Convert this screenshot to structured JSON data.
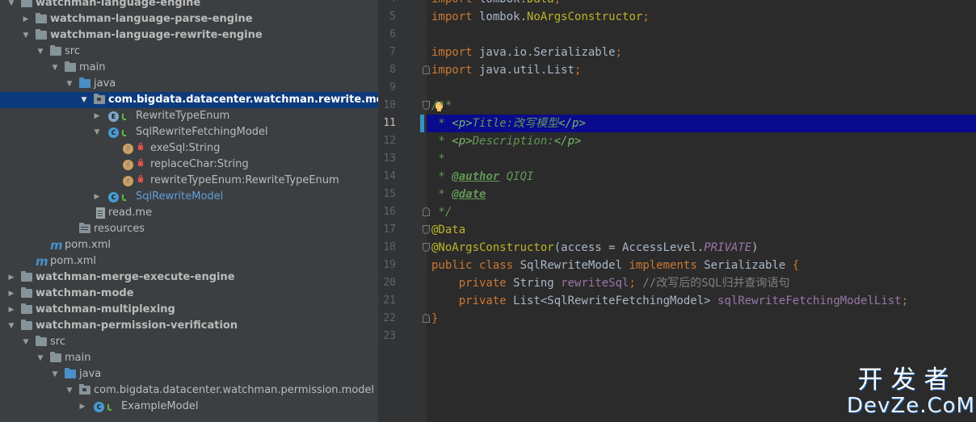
{
  "project_tree": {
    "items": [
      {
        "label": "watchman-language-engine",
        "expanded": true,
        "type": "module",
        "bold": true
      },
      {
        "label": "watchman-language-parse-engine",
        "expanded": false,
        "type": "module",
        "bold": true
      },
      {
        "label": "watchman-language-rewrite-engine",
        "expanded": true,
        "type": "module",
        "bold": true
      },
      {
        "label": "src",
        "expanded": true,
        "type": "folder"
      },
      {
        "label": "main",
        "expanded": true,
        "type": "folder"
      },
      {
        "label": "java",
        "expanded": true,
        "type": "source-folder"
      },
      {
        "label": "com.bigdata.datacenter.watchman.rewrite.model",
        "expanded": true,
        "type": "package",
        "selected": true
      },
      {
        "label": "RewriteTypeEnum",
        "expanded": false,
        "type": "enum"
      },
      {
        "label": "SqlRewriteFetchingModel",
        "expanded": true,
        "type": "class"
      },
      {
        "label": "exeSql:String",
        "type": "field"
      },
      {
        "label": "replaceChar:String",
        "type": "field"
      },
      {
        "label": "rewriteTypeEnum:RewriteTypeEnum",
        "type": "field"
      },
      {
        "label": "SqlRewriteModel",
        "expanded": false,
        "type": "class",
        "highlight": true
      },
      {
        "label": "read.me",
        "type": "file"
      },
      {
        "label": "resources",
        "type": "resources-folder"
      },
      {
        "label": "pom.xml",
        "type": "maven"
      },
      {
        "label": "pom.xml",
        "type": "maven"
      },
      {
        "label": "watchman-merge-execute-engine",
        "expanded": false,
        "type": "module",
        "bold": true
      },
      {
        "label": "watchman-mode",
        "expanded": false,
        "type": "module",
        "bold": true
      },
      {
        "label": "watchman-multiplexing",
        "expanded": false,
        "type": "module",
        "bold": true
      },
      {
        "label": "watchman-permission-verification",
        "expanded": true,
        "type": "module",
        "bold": true
      },
      {
        "label": "src",
        "expanded": true,
        "type": "folder"
      },
      {
        "label": "main",
        "expanded": true,
        "type": "folder"
      },
      {
        "label": "java",
        "expanded": true,
        "type": "source-folder"
      },
      {
        "label": "com.bigdata.datacenter.watchman.permission.model",
        "expanded": true,
        "type": "package"
      },
      {
        "label": "ExampleModel",
        "expanded": false,
        "type": "class"
      }
    ]
  },
  "editor": {
    "current_line": 11,
    "lines": [
      {
        "n": "4",
        "text": "import lombok.Data;"
      },
      {
        "n": "5",
        "text": "import lombok.NoArgsConstructor;"
      },
      {
        "n": "6",
        "text": ""
      },
      {
        "n": "7",
        "text": "import java.io.Serializable;"
      },
      {
        "n": "8",
        "text": "import java.util.List;"
      },
      {
        "n": "9",
        "text": ""
      },
      {
        "n": "10",
        "text": "/**"
      },
      {
        "n": "11",
        "text": " * <p>Title:改写模型</p>"
      },
      {
        "n": "12",
        "text": " * <p>Description:</p>"
      },
      {
        "n": "13",
        "text": " *"
      },
      {
        "n": "14",
        "text": " * @author QIQI"
      },
      {
        "n": "15",
        "text": " * @date"
      },
      {
        "n": "16",
        "text": " */"
      },
      {
        "n": "17",
        "text": "@Data"
      },
      {
        "n": "18",
        "text": "@NoArgsConstructor(access = AccessLevel.PRIVATE)"
      },
      {
        "n": "19",
        "text": "public class SqlRewriteModel implements Serializable {"
      },
      {
        "n": "20",
        "text": "    private String rewriteSql; //改写后的SQL归并查询语句"
      },
      {
        "n": "21",
        "text": "    private List<SqlRewriteFetchingModel> sqlRewriteFetchingModelList;"
      },
      {
        "n": "22",
        "text": "}"
      },
      {
        "n": "23",
        "text": ""
      }
    ]
  },
  "watermark": {
    "cn": "开发者",
    "en": "DevZe.CoM"
  },
  "colors": {
    "tree_bg": "#3c3f41",
    "editor_bg": "#2b2b2b",
    "selection": "#0d3a7c",
    "current_line": "#0a0a8c",
    "keyword": "#cc7832",
    "annotation": "#bbb529",
    "javadoc": "#629755",
    "field": "#9876aa"
  }
}
